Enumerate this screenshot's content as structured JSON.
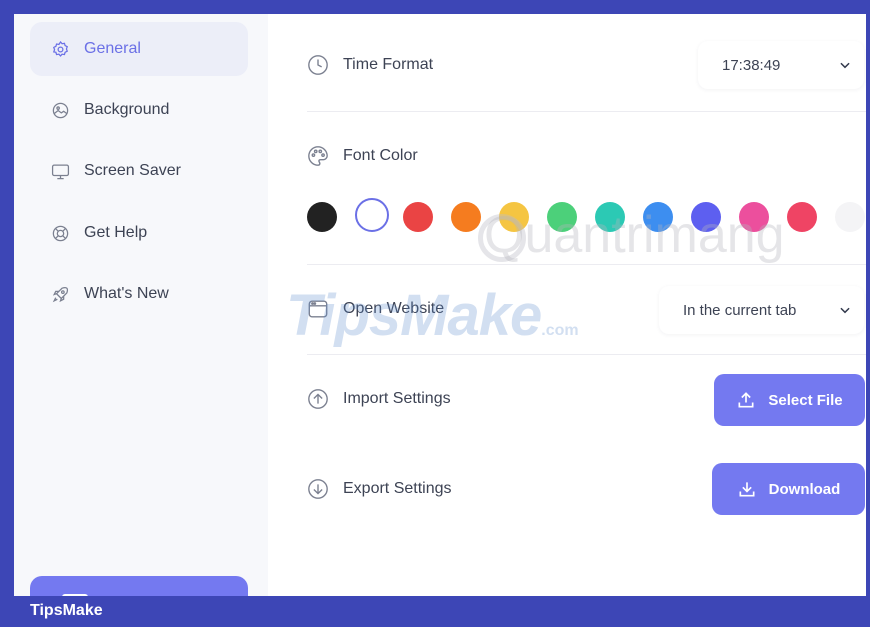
{
  "sidebar": {
    "items": [
      {
        "label": "General",
        "icon": "gear-icon",
        "active": true
      },
      {
        "label": "Background",
        "icon": "image-icon",
        "active": false
      },
      {
        "label": "Screen Saver",
        "icon": "monitor-icon",
        "active": false
      },
      {
        "label": "Get Help",
        "icon": "lifebuoy-icon",
        "active": false
      },
      {
        "label": "What's New",
        "icon": "rocket-icon",
        "active": false
      }
    ]
  },
  "settings": {
    "time_format": {
      "label": "Time Format",
      "value": "17:38:49",
      "icon": "clock-icon"
    },
    "font_color": {
      "label": "Font Color",
      "icon": "palette-icon",
      "swatches": [
        "#222222",
        "#ffffff",
        "#ea4444",
        "#f57c1f",
        "#f5c542",
        "#4cd07a",
        "#2cc9b4",
        "#3d8ef0",
        "#5d5ff0",
        "#ec4f9d",
        "#ef4464",
        "#f4f4f6"
      ],
      "selected_index": 1
    },
    "open_website": {
      "label": "Open Website",
      "value": "In the current tab",
      "icon": "browser-window-icon"
    },
    "import_settings": {
      "label": "Import Settings",
      "button": "Select File",
      "icon": "arrow-up-circle-icon"
    },
    "export_settings": {
      "label": "Export Settings",
      "button": "Download",
      "icon": "arrow-down-circle-icon"
    }
  },
  "colors": {
    "accent": "#7479f0",
    "frame": "#3d46b6"
  },
  "watermarks": {
    "tipsmake": "TipsMake",
    "tipsmake_suffix": ".com",
    "quantrimang": "Quantrimang"
  },
  "footer": {
    "brand": "TipsMake"
  }
}
